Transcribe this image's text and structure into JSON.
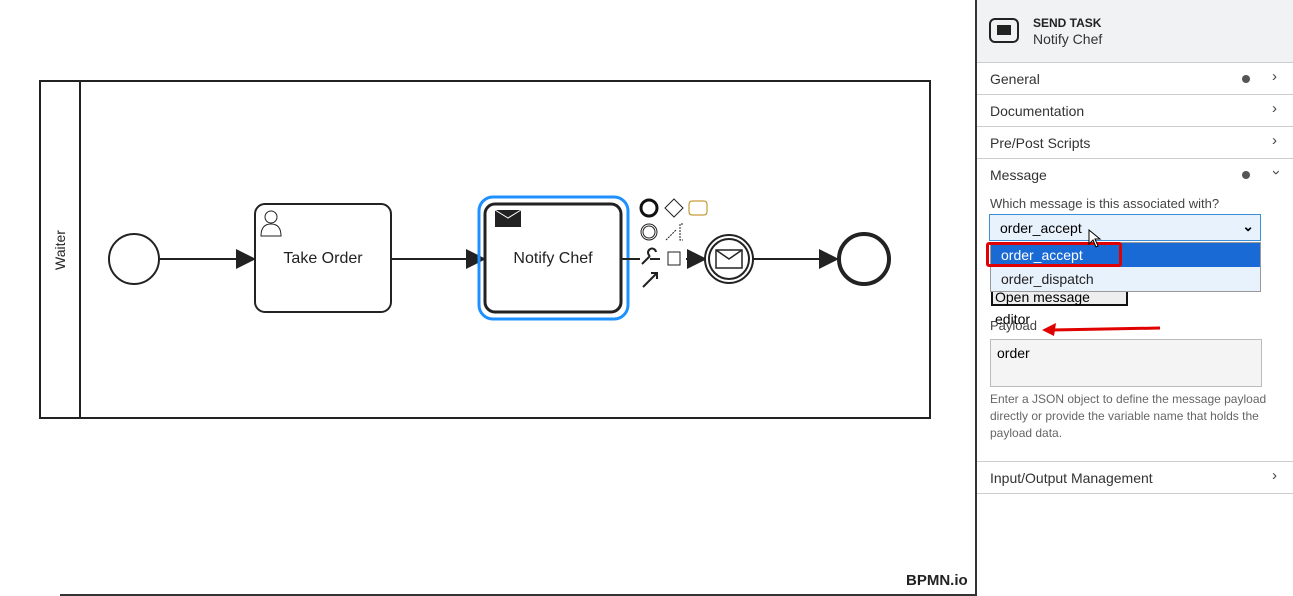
{
  "diagram": {
    "lane": "Waiter",
    "tasks": [
      "Take Order",
      "Notify Chef"
    ],
    "watermark": "BPMN.io",
    "selection_color": "#1e90ff"
  },
  "panel": {
    "type": "SEND TASK",
    "name": "Notify Chef",
    "groups": [
      {
        "label": "General",
        "dot": true
      },
      {
        "label": "Documentation",
        "dot": false
      },
      {
        "label": "Pre/Post Scripts",
        "dot": false
      },
      {
        "label": "Message",
        "dot": true
      }
    ],
    "message": {
      "question": "Which message is this associated with?",
      "selected": "order_accept",
      "options": [
        "order_accept",
        "order_dispatch"
      ],
      "open_editor": "Open message editor",
      "payload_label": "Payload",
      "payload_value": "order",
      "payload_help": "Enter a JSON object to define the message payload directly or provide the variable name that holds the payload data."
    },
    "io": "Input/Output Management"
  },
  "annotation_color": "#e00000"
}
